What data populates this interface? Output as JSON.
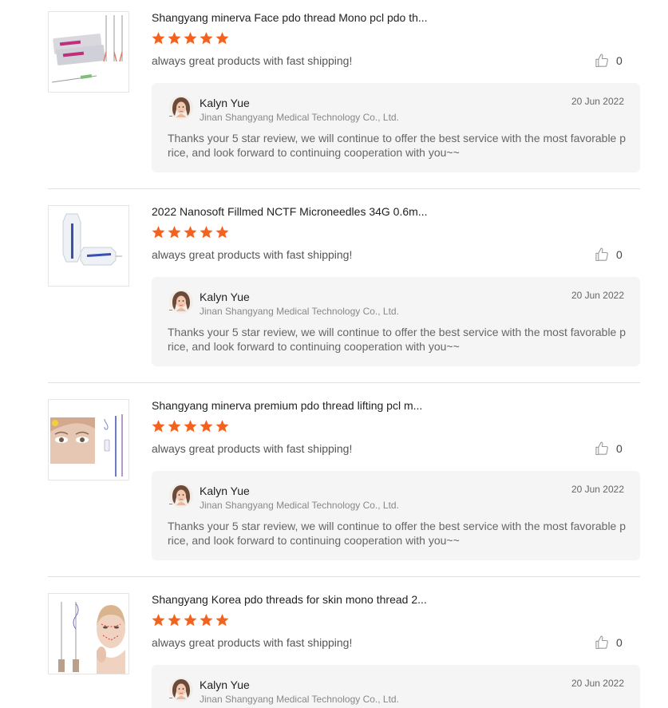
{
  "reviews": [
    {
      "product_title": "Shangyang minerva Face pdo thread Mono pcl pdo th...",
      "rating": 5,
      "comment": "always great products with fast shipping!",
      "likes": "0",
      "reply": {
        "name": "Kalyn Yue",
        "company": "Jinan Shangyang Medical Technology Co., Ltd.",
        "date": "20 Jun 2022",
        "text": "Thanks your 5 star review, we will continue to offer the best service with the most favorable price, and look forward to continuing cooperation with you~~"
      }
    },
    {
      "product_title": "2022 Nanosoft Fillmed NCTF Microneedles 34G 0.6m...",
      "rating": 5,
      "comment": "always great products with fast shipping!",
      "likes": "0",
      "reply": {
        "name": "Kalyn Yue",
        "company": "Jinan Shangyang Medical Technology Co., Ltd.",
        "date": "20 Jun 2022",
        "text": "Thanks your 5 star review, we will continue to offer the best service with the most favorable price, and look forward to continuing cooperation with you~~"
      }
    },
    {
      "product_title": "Shangyang minerva premium pdo thread lifting pcl m...",
      "rating": 5,
      "comment": "always great products with fast shipping!",
      "likes": "0",
      "reply": {
        "name": "Kalyn Yue",
        "company": "Jinan Shangyang Medical Technology Co., Ltd.",
        "date": "20 Jun 2022",
        "text": "Thanks your 5 star review, we will continue to offer the best service with the most favorable price, and look forward to continuing cooperation with you~~"
      }
    },
    {
      "product_title": "Shangyang Korea pdo threads for skin mono thread 2...",
      "rating": 5,
      "comment": "always great products with fast shipping!",
      "likes": "0",
      "reply": {
        "name": "Kalyn Yue",
        "company": "Jinan Shangyang Medical Technology Co., Ltd.",
        "date": "20 Jun 2022"
      }
    }
  ],
  "colors": {
    "star": "#f4631e",
    "reply_bg": "#f5f5f5",
    "divider": "#e0e0e0"
  },
  "icons": {
    "star": "star-icon",
    "like": "thumbs-up-icon",
    "avatar": "avatar"
  }
}
